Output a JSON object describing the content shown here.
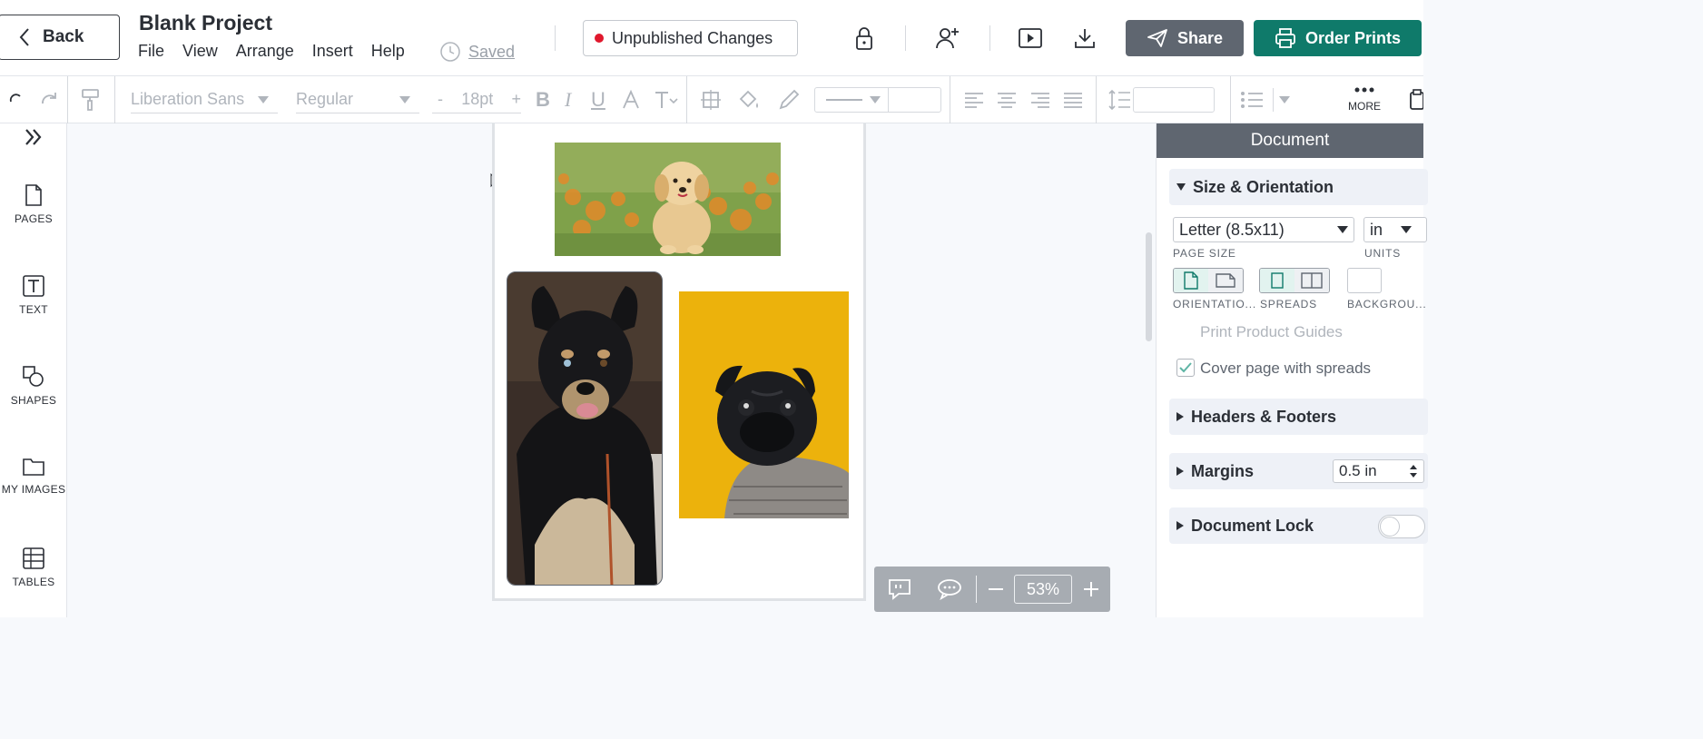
{
  "header": {
    "back_label": "Back",
    "project_title": "Blank Project",
    "menu": [
      "File",
      "View",
      "Arrange",
      "Insert",
      "Help"
    ],
    "saved_label": "Saved",
    "unpublished_label": "Unpublished Changes",
    "share_label": "Share",
    "order_prints_label": "Order Prints",
    "icons": [
      "lock-icon",
      "add-user-icon",
      "present-icon",
      "download-icon"
    ],
    "colors": {
      "share_bg": "#5f6670",
      "order_bg": "#0f7a6a",
      "unpublished_dot": "#e0182d"
    }
  },
  "toolbar": {
    "font_family": "Liberation Sans",
    "font_weight": "Regular",
    "font_size": "18pt",
    "decrement": "-",
    "increment": "+",
    "bold": "B",
    "italic": "I",
    "underline": "U",
    "more_label": "MORE"
  },
  "left_sidebar": {
    "items": [
      {
        "label": "PAGES",
        "icon": "page-icon"
      },
      {
        "label": "TEXT",
        "icon": "text-icon"
      },
      {
        "label": "SHAPES",
        "icon": "shapes-icon"
      },
      {
        "label": "MY IMAGES",
        "icon": "folder-icon"
      },
      {
        "label": "TABLES",
        "icon": "table-icon"
      }
    ]
  },
  "canvas": {
    "images": [
      "golden retriever puppy in flower field",
      "tricolor shepherd dog",
      "black pug in sweater on yellow background"
    ],
    "zoom": "53%"
  },
  "panel": {
    "title": "Document",
    "size_orientation": {
      "heading": "Size & Orientation",
      "page_size": "Letter (8.5x11)",
      "page_size_label": "PAGE SIZE",
      "units": "in",
      "units_label": "UNITS",
      "orientation_label": "ORIENTATIO...",
      "spreads_label": "SPREADS",
      "background_label": "BACKGROU...",
      "print_guides": "Print Product Guides",
      "cover_spreads": "Cover page with spreads",
      "cover_spreads_checked": true
    },
    "headers_footers": "Headers & Footers",
    "margins": {
      "label": "Margins",
      "value": "0.5 in"
    },
    "document_lock": {
      "label": "Document Lock",
      "enabled": false
    }
  }
}
